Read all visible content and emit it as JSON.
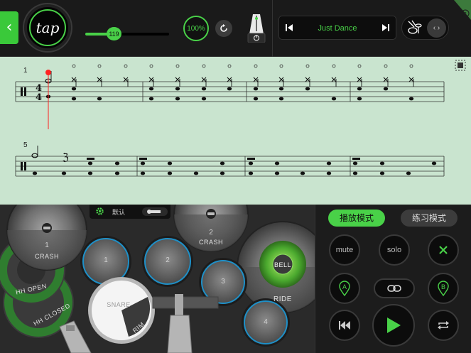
{
  "toolbar": {
    "back_icon": "chevron-left-icon",
    "tap_label": "tap",
    "tempo_value": "119",
    "tempo_fraction": 0.3,
    "speed_label": "100%",
    "song_title": "Just Dance",
    "accent_color": "#49d148"
  },
  "score": {
    "measure_number_1": "1",
    "measure_number_2": "5"
  },
  "drum_kit": {
    "setting_label": "默认",
    "crash1_number": "1",
    "crash1_label": "CRASH",
    "crash2_number": "2",
    "crash2_label": "CRASH",
    "hihat_open_label": "HH OPEN",
    "hihat_closed_label": "HH CLOSED",
    "tom1_number": "1",
    "tom2_number": "2",
    "tom3_number": "3",
    "tom4_number": "4",
    "snare_label": "SNARE",
    "rim_label": "RIM",
    "bell_label": "BELL",
    "ride_label": "RIDE"
  },
  "control": {
    "mode_play": "播放模式",
    "mode_practice": "练习模式",
    "mute_label": "mute",
    "solo_label": "solo",
    "marker_a": "A",
    "marker_b": "B"
  }
}
